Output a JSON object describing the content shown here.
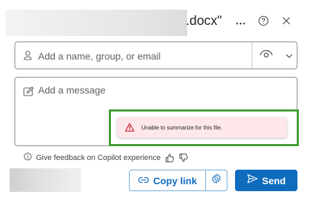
{
  "header": {
    "title_suffix": ".docx\"",
    "icons": [
      "more-icon",
      "help-icon",
      "close-icon"
    ]
  },
  "people": {
    "placeholder": "Add a name, group, or email",
    "icons": [
      "person-icon",
      "eye-icon",
      "chevron-down-icon"
    ]
  },
  "message": {
    "placeholder": "Add a message",
    "icon": "edit-icon"
  },
  "toast": {
    "text": "Unable to summarize for this file.",
    "icon": "warning-icon",
    "background": "#fde7e9",
    "icon_color": "#c50f1f"
  },
  "highlight": {
    "color": "#3e9a2f"
  },
  "feedback": {
    "text": "Give feedback on Copilot experience",
    "icons": [
      "info-icon",
      "thumbs-up-icon",
      "thumbs-down-icon"
    ]
  },
  "footer": {
    "copy_link_label": "Copy link",
    "send_label": "Send",
    "accent": "#0f6cbd",
    "icons": [
      "link-icon",
      "settings-icon",
      "send-icon"
    ]
  }
}
